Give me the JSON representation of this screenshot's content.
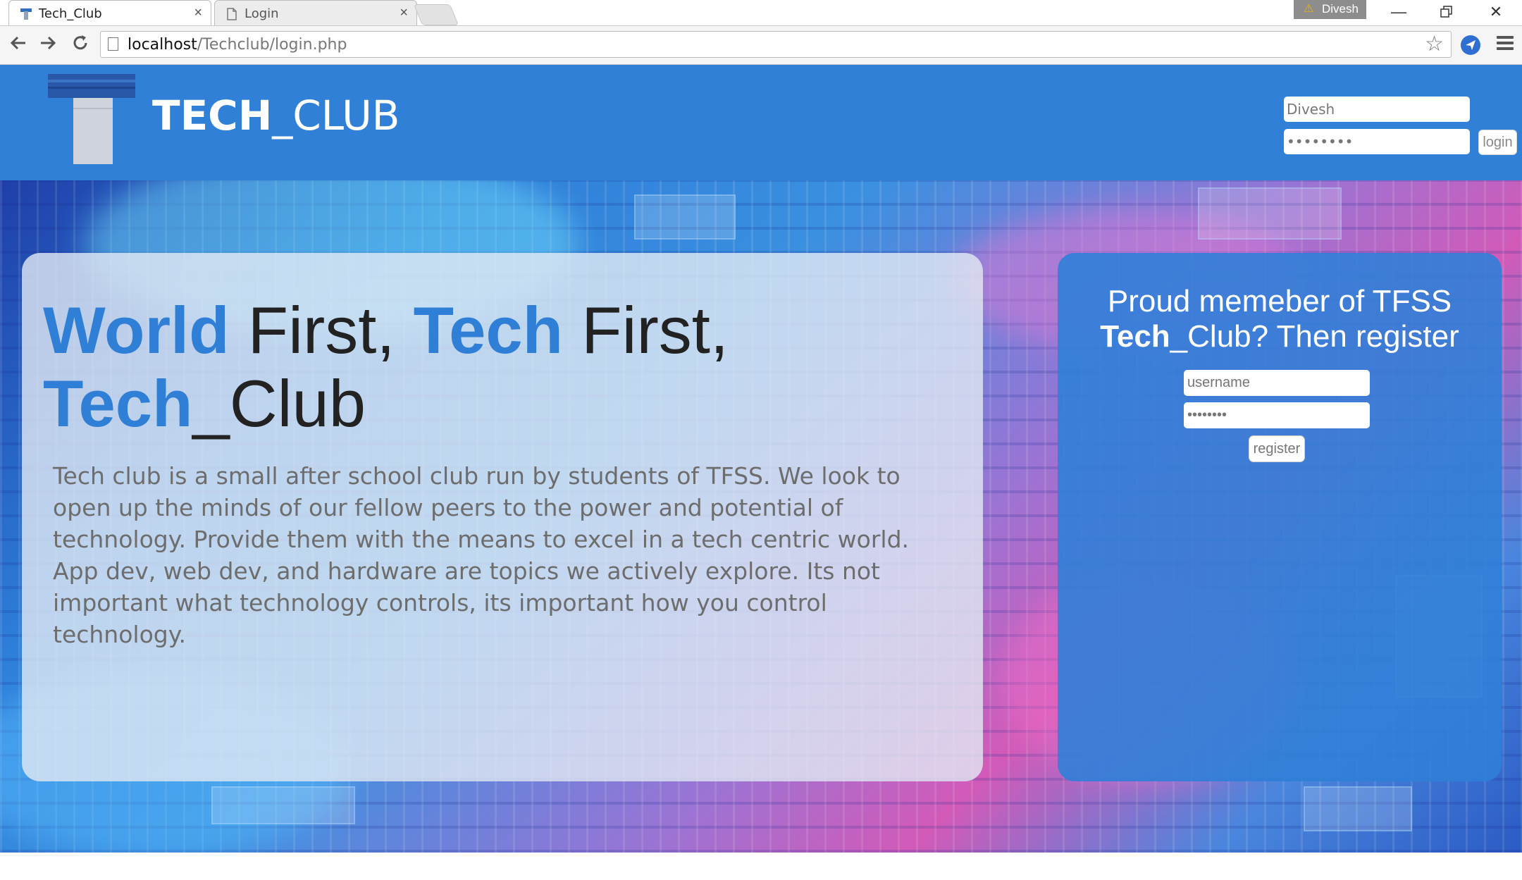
{
  "browser": {
    "tabs": [
      {
        "title": "Tech_Club",
        "active": true
      },
      {
        "title": "Login",
        "active": false
      }
    ],
    "profile_name": "Divesh",
    "url_host": "localhost",
    "url_path": "/Techclub/login.php"
  },
  "header": {
    "brand_bold": "TECH",
    "brand_rest": "_CLUB",
    "username_value": "Divesh",
    "password_value": "••••••••",
    "login_label": "login"
  },
  "hero": {
    "headline_parts": [
      "World",
      " First, ",
      "Tech",
      " First,",
      "Tech",
      "_Club"
    ],
    "description": "Tech club is a small after school club run by students of TFSS. We look to open up the minds of our fellow peers to the power and potential of technology. Provide them with the means to excel in a tech centric world. App dev, web dev, and hardware are topics we actively explore. Its not important what technology controls, its important how you control technology."
  },
  "register": {
    "title_line1": "Proud memeber of TFSS",
    "title_bold": "Tech",
    "title_rest": "_Club? Then register",
    "username_placeholder": "username",
    "password_value": "••••••••",
    "button_label": "register"
  },
  "colors": {
    "header_blue": "#3080d8",
    "accent_blue": "#2f7fd6"
  }
}
